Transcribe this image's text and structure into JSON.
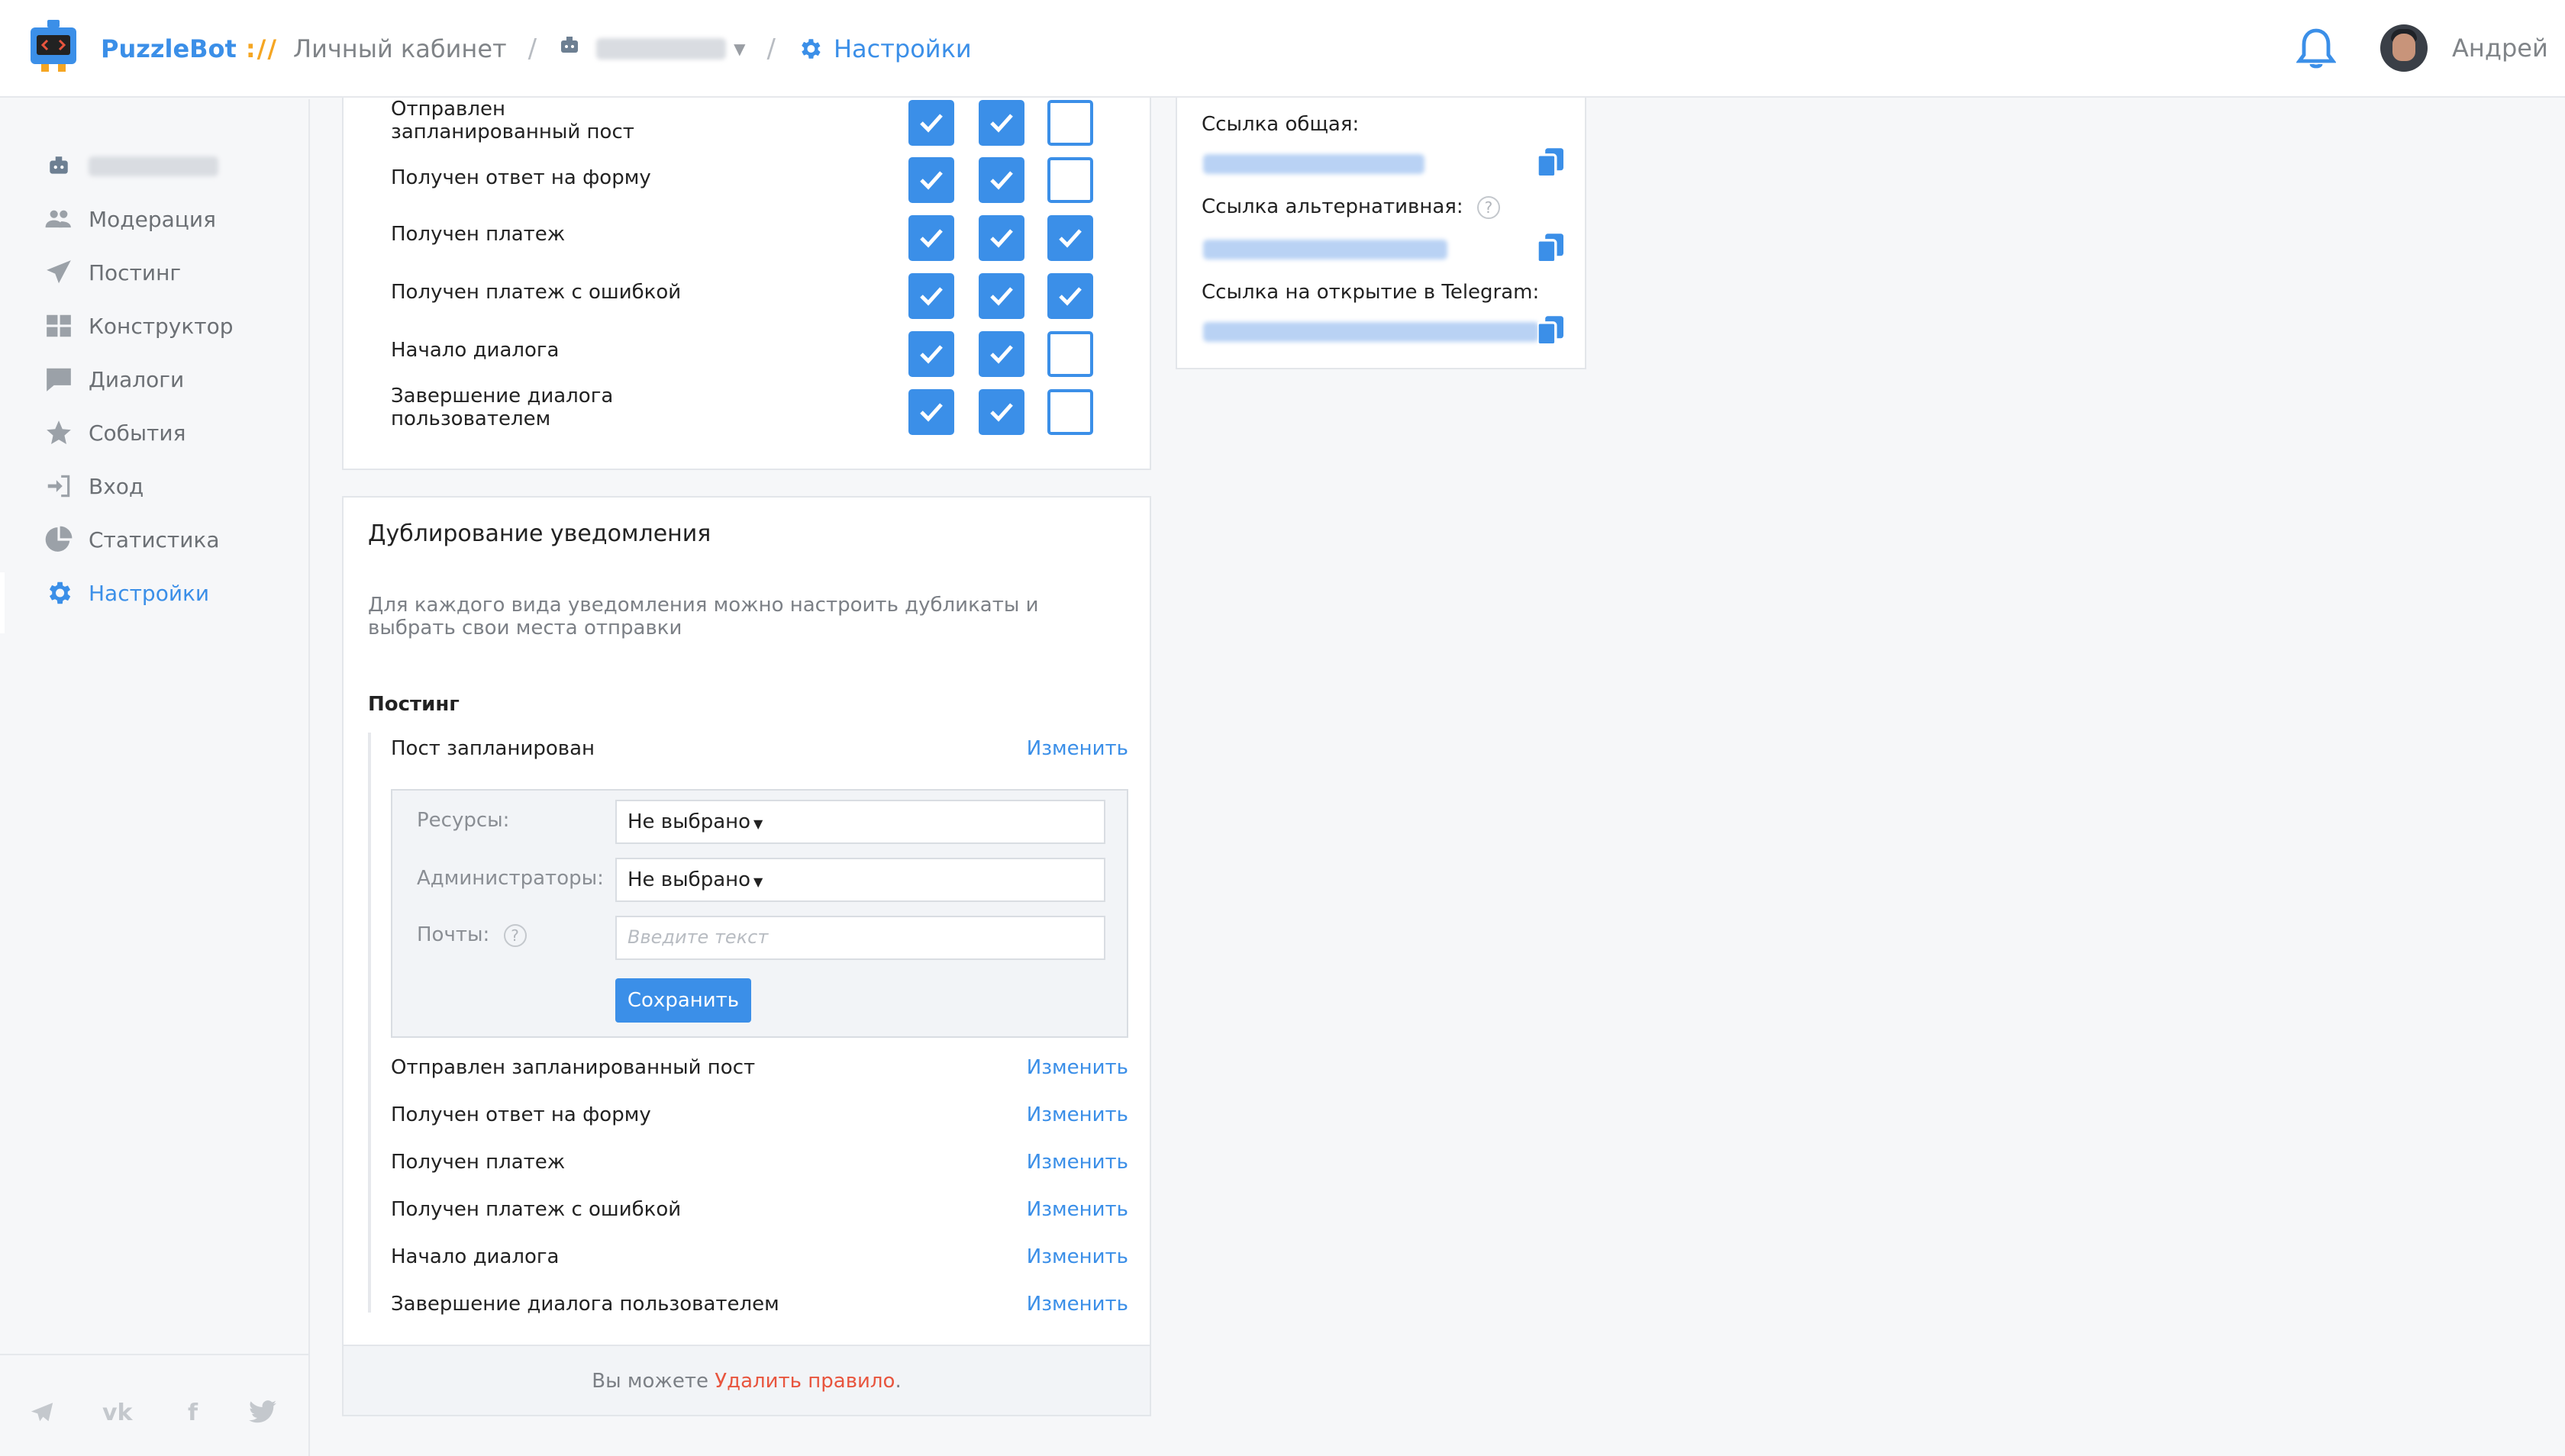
{
  "header": {
    "brand": "PuzzleBot",
    "brand_sep": "://",
    "cabinet": "Личный кабинет",
    "settings": "Настройки",
    "username": "Андрей"
  },
  "sidebar": {
    "items": [
      {
        "label": "Модерация",
        "icon": "users-icon"
      },
      {
        "label": "Постинг",
        "icon": "paper-plane-icon"
      },
      {
        "label": "Конструктор",
        "icon": "grid-icon"
      },
      {
        "label": "Диалоги",
        "icon": "chat-icon"
      },
      {
        "label": "События",
        "icon": "star-icon"
      },
      {
        "label": "Вход",
        "icon": "sign-in-icon"
      },
      {
        "label": "Статистика",
        "icon": "pie-chart-icon"
      },
      {
        "label": "Настройки",
        "icon": "gear-icon",
        "active": true
      }
    ],
    "social": [
      "telegram-icon",
      "vk-icon",
      "facebook-icon",
      "twitter-icon"
    ]
  },
  "notifications_table": {
    "rows": [
      {
        "label_line1": "Отправлен",
        "label_line2": "запланированный пост",
        "checks": [
          true,
          true,
          false
        ]
      },
      {
        "label_line1": "Получен ответ на форму",
        "label_line2": "",
        "checks": [
          true,
          true,
          false
        ]
      },
      {
        "label_line1": "Получен платеж",
        "label_line2": "",
        "checks": [
          true,
          true,
          true
        ]
      },
      {
        "label_line1": "Получен платеж с ошибкой",
        "label_line2": "",
        "checks": [
          true,
          true,
          true
        ]
      },
      {
        "label_line1": "Начало диалога",
        "label_line2": "",
        "checks": [
          true,
          true,
          false
        ]
      },
      {
        "label_line1": "Завершение диалога",
        "label_line2": "пользователем",
        "checks": [
          true,
          true,
          false
        ]
      }
    ]
  },
  "links": {
    "common_label": "Ссылка общая:",
    "alt_label": "Ссылка альтернативная:",
    "alt_help": "?",
    "telegram_label": "Ссылка на открытие в Telegram:"
  },
  "duplication": {
    "title": "Дублирование уведомления",
    "description": "Для каждого вида уведомления можно настроить дубликаты и выбрать свои места отправки",
    "section": "Постинг",
    "edit_label": "Изменить",
    "first_rule": "Пост запланирован",
    "editor": {
      "resources_label": "Ресурсы:",
      "resources_value": "Не выбрано",
      "admins_label": "Администраторы:",
      "admins_value": "Не выбрано",
      "emails_label": "Почты:",
      "emails_help": "?",
      "emails_placeholder": "Введите текст",
      "save": "Сохранить"
    },
    "rules": [
      "Отправлен запланированный пост",
      "Получен ответ на форму",
      "Получен платеж",
      "Получен платеж с ошибкой",
      "Начало диалога",
      "Завершение диалога пользователем"
    ],
    "footer_prefix": "Вы можете ",
    "footer_link": "Удалить правило",
    "footer_suffix": "."
  },
  "colors": {
    "accent": "#3b8fe8",
    "brand_sep": "#f5a623",
    "danger_link": "#e8553e"
  }
}
